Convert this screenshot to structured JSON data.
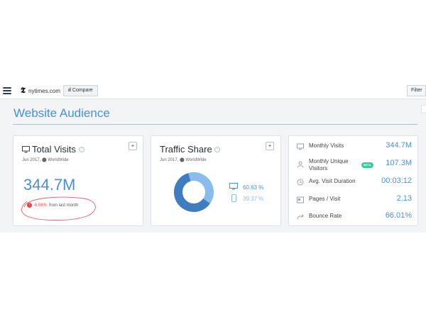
{
  "topbar": {
    "site_logo": "𝕿",
    "site_name": "nytimes.com",
    "compare_label": "Compare",
    "filter_label": "Filter"
  },
  "page": {
    "title": "Website Audience"
  },
  "total_visits": {
    "title": "Total Visits",
    "subtitle": "Jun 2017, ⬤ WorldWide",
    "value": "344.7M",
    "change_pct": "-6.08%",
    "change_text": "from last month",
    "plus": "+"
  },
  "traffic_share": {
    "title": "Traffic Share",
    "subtitle": "Jun 2017, ⬤ WorldWide",
    "desktop_pct": "60.63 %",
    "mobile_pct": "39.37 %",
    "desktop_fraction": 0.6063,
    "mobile_fraction": 0.3937,
    "desktop_color": "#3f7dc0",
    "mobile_color": "#8bbdec",
    "plus": "+"
  },
  "metrics": {
    "items": [
      {
        "label": "Monthly Visits",
        "value": "344.7M",
        "icon": "monitor-icon"
      },
      {
        "label": "Monthly Unique Visitors",
        "value": "107.3M",
        "icon": "user-icon",
        "badge": "BETA"
      },
      {
        "label": "Avg. Visit Duration",
        "value": "00:03:12",
        "icon": "clock-icon"
      },
      {
        "label": "Pages / Visit",
        "value": "2.13",
        "icon": "pages-icon"
      },
      {
        "label": "Bounce Rate",
        "value": "66.01%",
        "icon": "bounce-icon"
      }
    ]
  },
  "colors": {
    "accent": "#4a90d9",
    "negative": "#e0444d",
    "beta_badge": "#3cc6a0"
  }
}
